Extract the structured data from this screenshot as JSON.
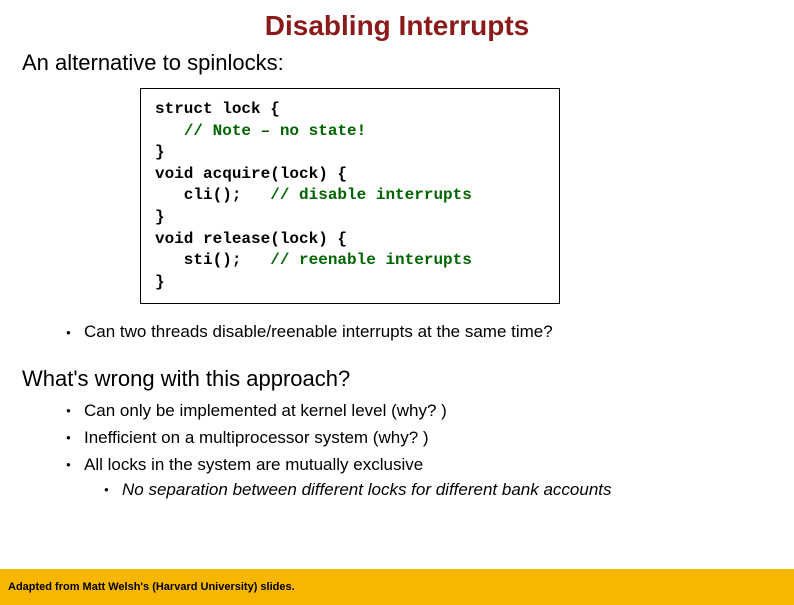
{
  "title": "Disabling Interrupts",
  "subtitle": "An alternative to spinlocks:",
  "code": {
    "l1a": "struct lock {",
    "l2a": "   ",
    "l2b": "// Note – no state!",
    "l3a": "}",
    "l4a": "void acquire(lock) {",
    "l5a": "   cli();   ",
    "l5b": "// disable interrupts",
    "l6a": "}",
    "l7a": "void release(lock) {",
    "l8a": "   sti();   ",
    "l8b": "// reenable interupts",
    "l9a": "}"
  },
  "bullet1": "Can two threads disable/reenable interrupts at the same time?",
  "question": "What's wrong with this approach?",
  "subbullets": [
    "Can only be implemented at kernel level (why? )",
    "Inefficient on a multiprocessor system (why? )",
    "All locks in the system are mutually exclusive"
  ],
  "nested": "No separation between different locks for different bank accounts",
  "footer": "Adapted from Matt Welsh's (Harvard University) slides."
}
